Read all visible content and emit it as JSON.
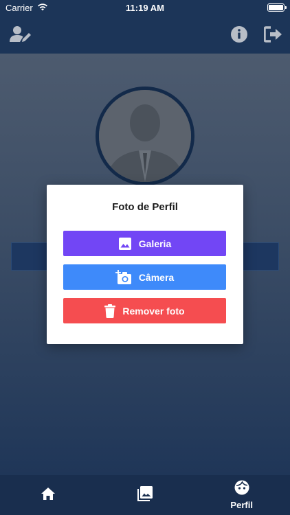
{
  "status_bar": {
    "carrier": "Carrier",
    "time": "11:19 AM"
  },
  "header": {
    "left_icon": "edit-profile-icon",
    "right_icons": [
      "info-icon",
      "logout-icon"
    ]
  },
  "modal": {
    "title": "Foto de Perfil",
    "buttons": [
      {
        "label": "Galeria",
        "icon": "image-icon",
        "color": "#7246f5"
      },
      {
        "label": "Câmera",
        "icon": "add-camera-icon",
        "color": "#3e8afa"
      },
      {
        "label": "Remover foto",
        "icon": "trash-icon",
        "color": "#f54d50"
      }
    ]
  },
  "bottom_nav": {
    "items": [
      {
        "icon": "home-icon",
        "label": ""
      },
      {
        "icon": "gallery-icon",
        "label": ""
      },
      {
        "icon": "profile-face-icon",
        "label": "Perfil"
      }
    ]
  }
}
